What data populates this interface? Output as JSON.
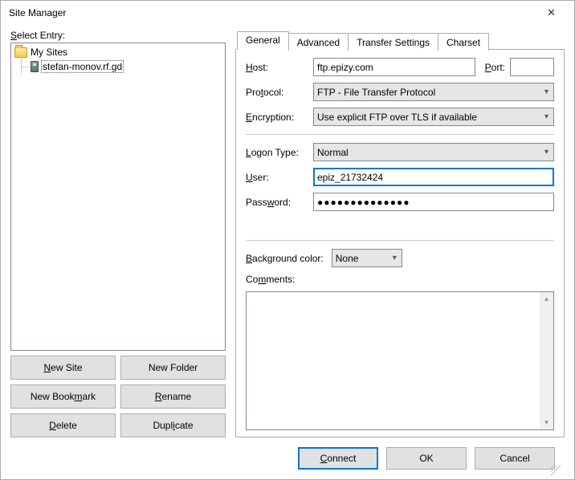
{
  "window": {
    "title": "Site Manager",
    "close_label": "✕"
  },
  "left": {
    "select_entry_pre": "S",
    "select_entry_post": "elect Entry:",
    "sites_root": "My Sites",
    "site_entry": "stefan-monov.rf.gd",
    "buttons": {
      "new_site_pre": "N",
      "new_site_post": "ew Site",
      "new_folder": "New Folder",
      "new_bookmark_pre": "New Book",
      "new_bookmark_u": "m",
      "new_bookmark_post": "ark",
      "rename_pre": "R",
      "rename_post": "ename",
      "delete_pre": "D",
      "delete_post": "elete",
      "duplicate_pre": "Dupl",
      "duplicate_u": "i",
      "duplicate_post": "cate"
    }
  },
  "tabs": {
    "general": "General",
    "advanced": "Advanced",
    "transfer": "Transfer Settings",
    "charset": "Charset"
  },
  "form": {
    "host_lbl_u": "H",
    "host_lbl_post": "ost:",
    "host_value": "ftp.epizy.com",
    "port_lbl_u": "P",
    "port_lbl_post": "ort:",
    "port_value": "",
    "protocol_lbl_pre": "Pro",
    "protocol_lbl_u": "t",
    "protocol_lbl_post": "ocol:",
    "protocol_value": "FTP - File Transfer Protocol",
    "encryption_lbl_u": "E",
    "encryption_lbl_post": "ncryption:",
    "encryption_value": "Use explicit FTP over TLS if available",
    "logon_lbl_u": "L",
    "logon_lbl_post": "ogon Type:",
    "logon_value": "Normal",
    "user_lbl_u": "U",
    "user_lbl_post": "ser:",
    "user_value": "epiz_21732424",
    "password_lbl_pre": "Pass",
    "password_lbl_u": "w",
    "password_lbl_post": "ord:",
    "password_value": "●●●●●●●●●●●●●●",
    "bgcolor_lbl_u": "B",
    "bgcolor_lbl_post": "ackground color:",
    "bgcolor_value": "None",
    "comments_lbl_pre": "Co",
    "comments_lbl_u": "m",
    "comments_lbl_post": "ments:"
  },
  "bottom": {
    "connect_u": "C",
    "connect_post": "onnect",
    "ok": "OK",
    "cancel": "Cancel"
  }
}
